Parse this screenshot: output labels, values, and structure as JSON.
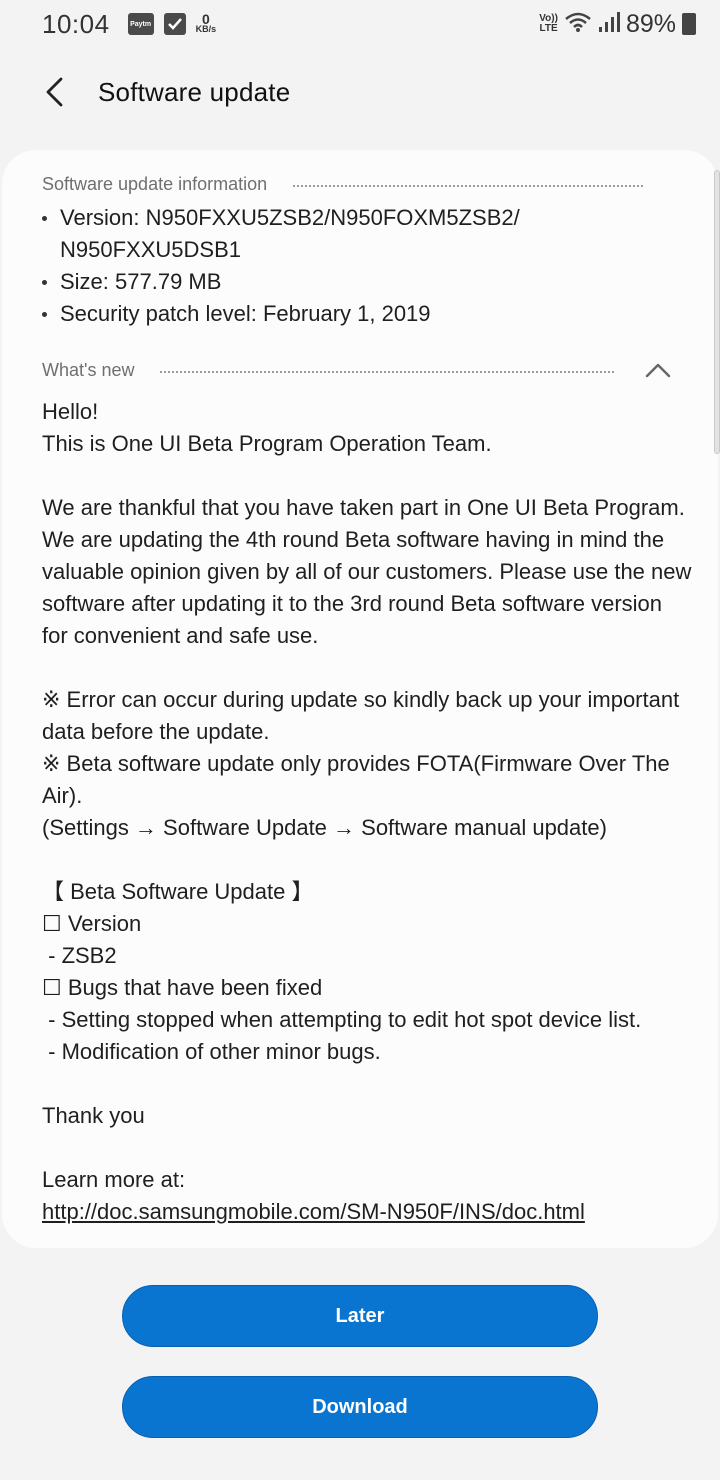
{
  "status_bar": {
    "time": "10:04",
    "paytm_label": "Paytm",
    "net_speed_value": "0",
    "net_speed_unit": "KB/s",
    "volte_top": "Vo))",
    "volte_bottom": "LTE",
    "battery": "89%"
  },
  "header": {
    "title": "Software update"
  },
  "info_section": {
    "heading": "Software update information",
    "items": [
      "Version: N950FXXU5ZSB2/N950FOXM5ZSB2/\nN950FXXU5DSB1",
      "Size: 577.79 MB",
      "Security patch level: February 1, 2019"
    ]
  },
  "whats_new": {
    "heading": "What's new",
    "paragraphs": [
      "Hello!\nThis is One UI Beta Program Operation Team.",
      "We are thankful that you have taken part in One UI Beta Program. We are updating the 4th round Beta software having in mind the valuable opinion given by all of our customers. Please use the new software after updating it to the 3rd round Beta software version for convenient and safe use.",
      "※ Error can occur during update so kindly back up your important data before the update.\n※ Beta software update only provides FOTA(Firmware Over The Air).\n(Settings → Software Update → Software manual update)",
      "【 Beta Software Update 】\n☐ Version\n - ZSB2\n☐ Bugs that have been fixed\n - Setting stopped when attempting to edit hot spot device list.\n - Modification of other minor bugs.",
      "Thank you",
      "Learn more at:"
    ],
    "link": "http://doc.samsungmobile.com/SM-N950F/INS/doc.html"
  },
  "buttons": {
    "later": "Later",
    "download": "Download"
  },
  "colors": {
    "accent": "#0a75d1",
    "background": "#f3f3f3",
    "card": "#fcfcfc"
  }
}
